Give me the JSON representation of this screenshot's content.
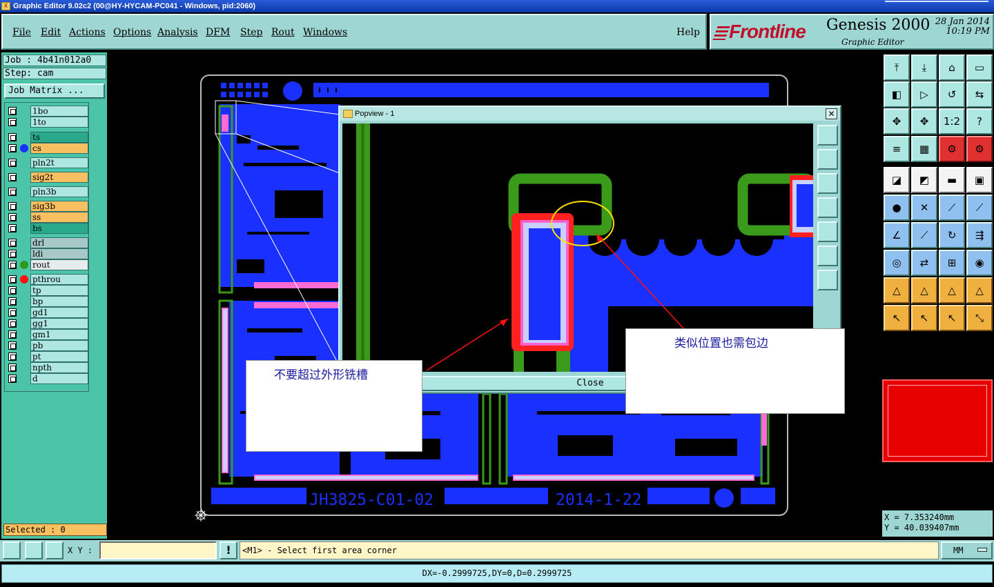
{
  "window": {
    "title": "Graphic Editor 9.02c2 (00@HY-HYCAM-PC041 - Windows, pid:2060)"
  },
  "menu": [
    "File",
    "Edit",
    "Actions",
    "Options",
    "Analysis",
    "DFM",
    "Step",
    "Rout",
    "Windows"
  ],
  "help": "Help",
  "brand": {
    "logo": "Frontline",
    "product": "Genesis 2000",
    "subtitle": "Graphic Editor",
    "date": "28 Jan 2014",
    "time": "10:19 PM"
  },
  "job": {
    "job_line": "Job : 4b41n012a0",
    "step_line": "Step: cam",
    "matrix_button": "Job Matrix ..."
  },
  "layers": [
    {
      "name": "1bo",
      "color": "#aee6e2"
    },
    {
      "name": "1to",
      "color": "#aee6e2"
    },
    {
      "name": "ts",
      "color": "#2aaa8a"
    },
    {
      "name": "cs",
      "color": "#f8c060",
      "dot": "#1a30ff"
    },
    {
      "name": "pln2t",
      "color": "#aee6e2"
    },
    {
      "name": "sig2t",
      "color": "#f8c060"
    },
    {
      "name": "pln3b",
      "color": "#aee6e2"
    },
    {
      "name": "sig3b",
      "color": "#f8c060"
    },
    {
      "name": "ss",
      "color": "#f8c060"
    },
    {
      "name": "bs",
      "color": "#2aaa8a"
    },
    {
      "name": "drl",
      "color": "#a8c8c8"
    },
    {
      "name": "ldi",
      "color": "#a8c8c8"
    },
    {
      "name": "rout",
      "color": "#e6ecec",
      "dot": "#2a9a1a"
    },
    {
      "name": "pthrou",
      "color": "#aee6e2",
      "dot": "#ff1010",
      "sel": true
    },
    {
      "name": "tp",
      "color": "#aee6e2"
    },
    {
      "name": "bp",
      "color": "#aee6e2"
    },
    {
      "name": "gd1",
      "color": "#aee6e2"
    },
    {
      "name": "gg1",
      "color": "#aee6e2"
    },
    {
      "name": "gm1",
      "color": "#aee6e2"
    },
    {
      "name": "pb",
      "color": "#aee6e2"
    },
    {
      "name": "pt",
      "color": "#aee6e2"
    },
    {
      "name": "npth",
      "color": "#aee6e2"
    },
    {
      "name": "d",
      "color": "#aee6e2"
    }
  ],
  "selected_text": "Selected : 0",
  "board": {
    "text_left": "JH3825-C01-02",
    "text_right": "2014-1-22"
  },
  "popview": {
    "title": "Popview - 1",
    "close_label": "Close"
  },
  "notes": {
    "left": "不要超过外形铣槽",
    "right": "类似位置也需包边"
  },
  "coords": {
    "x": "X = 7.353240mm",
    "y": "Y = 40.039407mm"
  },
  "bottom": {
    "xy_label": "X Y :",
    "xy_value": "",
    "message": "<M1> - Select first area corner",
    "units": "MM"
  },
  "status": "DX=-0.2999725,DY=0,D=0.2999725"
}
